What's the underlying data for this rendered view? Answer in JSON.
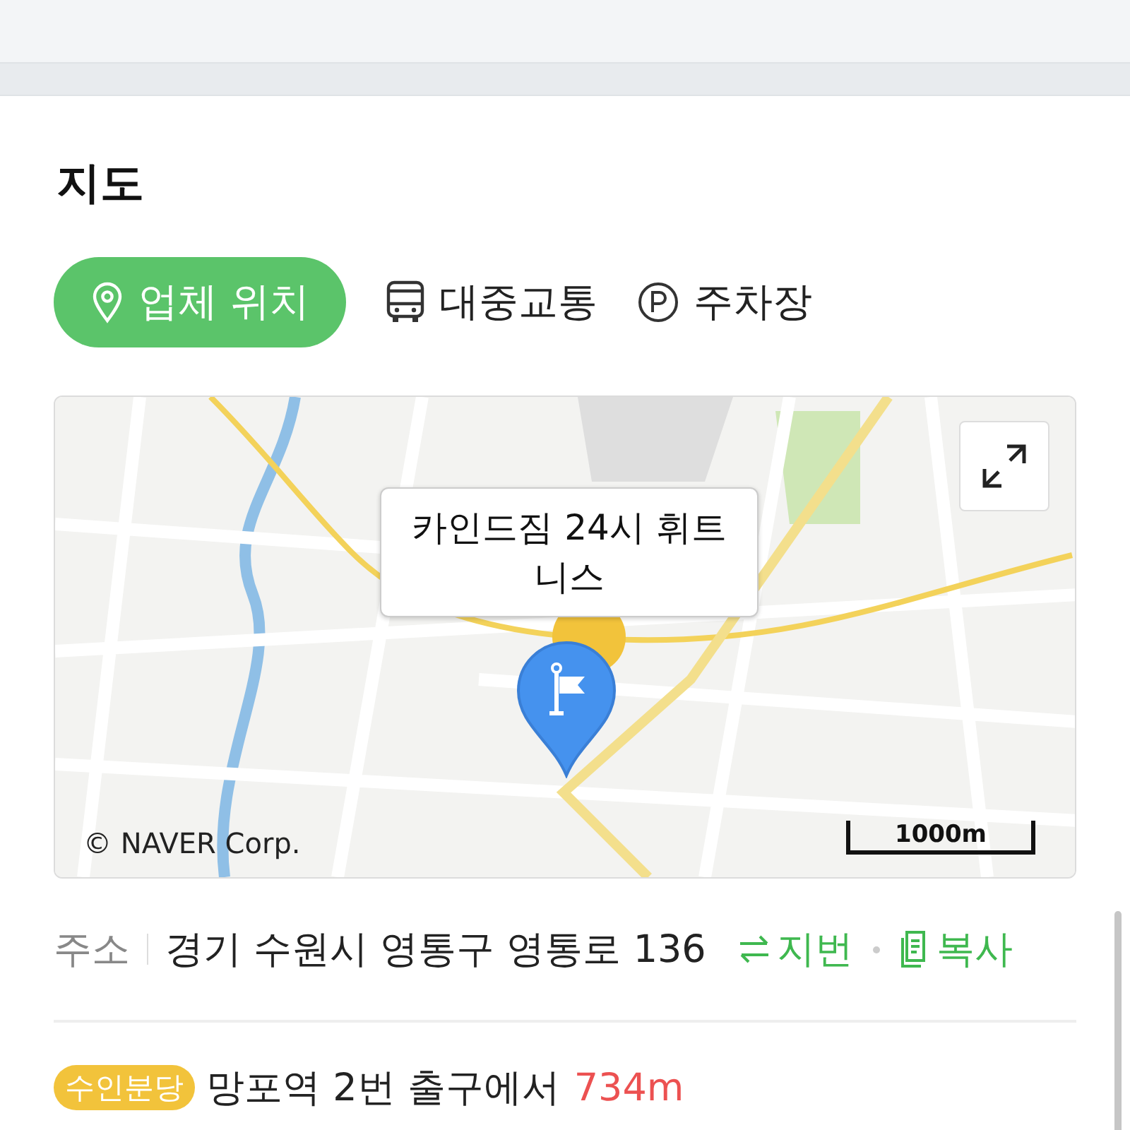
{
  "section_title": "지도",
  "tabs": [
    {
      "label": "업체 위치",
      "selected": true,
      "kind": "pin"
    },
    {
      "label": "대중교통",
      "selected": false,
      "kind": "bus"
    },
    {
      "label": "주차장",
      "selected": false,
      "kind": "parking"
    }
  ],
  "map": {
    "kind": "picture",
    "place_label": "카인드짐 24시 휘트니스",
    "scale": "1000m",
    "copyright": "© NAVER Corp."
  },
  "address": {
    "label": "주소",
    "value": "경기 수원시 영통구 영통로 136",
    "actions": [
      {
        "label": "지번",
        "kind": "swap"
      },
      {
        "label": "복사",
        "kind": "copy"
      }
    ]
  },
  "stations": [
    {
      "line": "수인분당",
      "color": "#f2c33b",
      "description": "망포역 2번 출구에서",
      "distance": "734m"
    }
  ]
}
